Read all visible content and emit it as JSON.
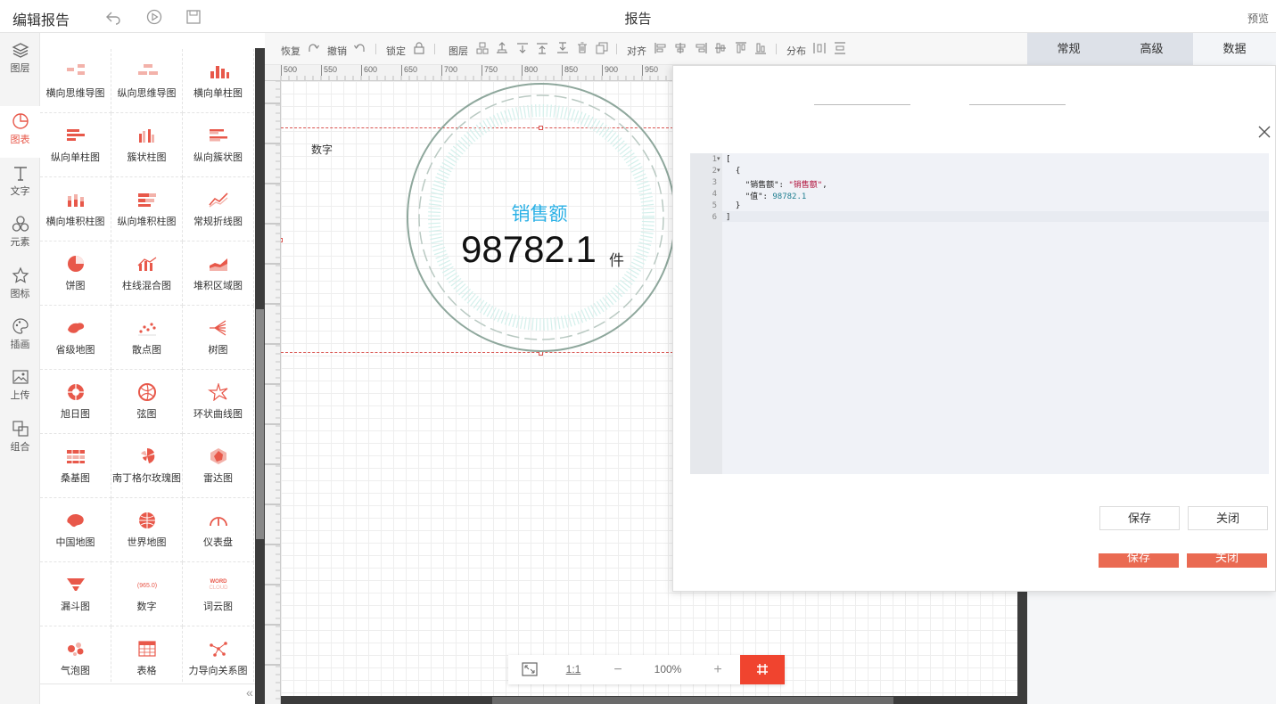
{
  "header": {
    "app_title": "编辑报告",
    "page_title": "报告",
    "preview": "预览"
  },
  "rail": [
    {
      "label": "图层",
      "icon": "layers-icon"
    },
    {
      "label": "图表",
      "icon": "chart-pie-icon",
      "active": true
    },
    {
      "label": "文字",
      "icon": "text-icon"
    },
    {
      "label": "元素",
      "icon": "elements-icon"
    },
    {
      "label": "图标",
      "icon": "star-icon"
    },
    {
      "label": "插画",
      "icon": "palette-icon"
    },
    {
      "label": "上传",
      "icon": "upload-image-icon"
    },
    {
      "label": "组合",
      "icon": "group-icon"
    }
  ],
  "palette": [
    "横向思维导图",
    "纵向思维导图",
    "横向单柱图",
    "纵向单柱图",
    "簇状柱图",
    "纵向簇状图",
    "横向堆积柱图",
    "纵向堆积柱图",
    "常规折线图",
    "饼图",
    "柱线混合图",
    "堆积区域图",
    "省级地图",
    "散点图",
    "树图",
    "旭日图",
    "弦图",
    "环状曲线图",
    "桑基图",
    "南丁格尔玫瑰图",
    "雷达图",
    "中国地图",
    "世界地图",
    "仪表盘",
    "漏斗图",
    "数字",
    "词云图",
    "气泡图",
    "表格",
    "力导向关系图"
  ],
  "palette_icon_color": "#e8584a",
  "toolbar": {
    "redo": "恢复",
    "undo": "撤销",
    "lock": "锁定",
    "layer": "图层",
    "align": "对齐",
    "distribute": "分布"
  },
  "ruler": {
    "marks": [
      "500",
      "550",
      "600",
      "650",
      "700",
      "750",
      "800",
      "850",
      "900",
      "950"
    ]
  },
  "widget": {
    "label": "数字",
    "metric_name": "销售额",
    "metric_value": "98782.1",
    "unit": "件",
    "metric_color": "#2cb1e6"
  },
  "zoom": {
    "fit": "",
    "one_to_one": "1:1",
    "minus": "−",
    "level": "100%",
    "plus": "+"
  },
  "right_tabs": [
    "常规",
    "高级",
    "数据"
  ],
  "editor": {
    "line_numbers": [
      "1",
      "2",
      "3",
      "4",
      "5",
      "6"
    ],
    "key1": "\"销售额\"",
    "val1": "\"销售额\"",
    "key2": "\"值\"",
    "val2": "98782.1"
  },
  "modal": {
    "save": "保存",
    "close": "关闭"
  },
  "accent": "#f0442f"
}
